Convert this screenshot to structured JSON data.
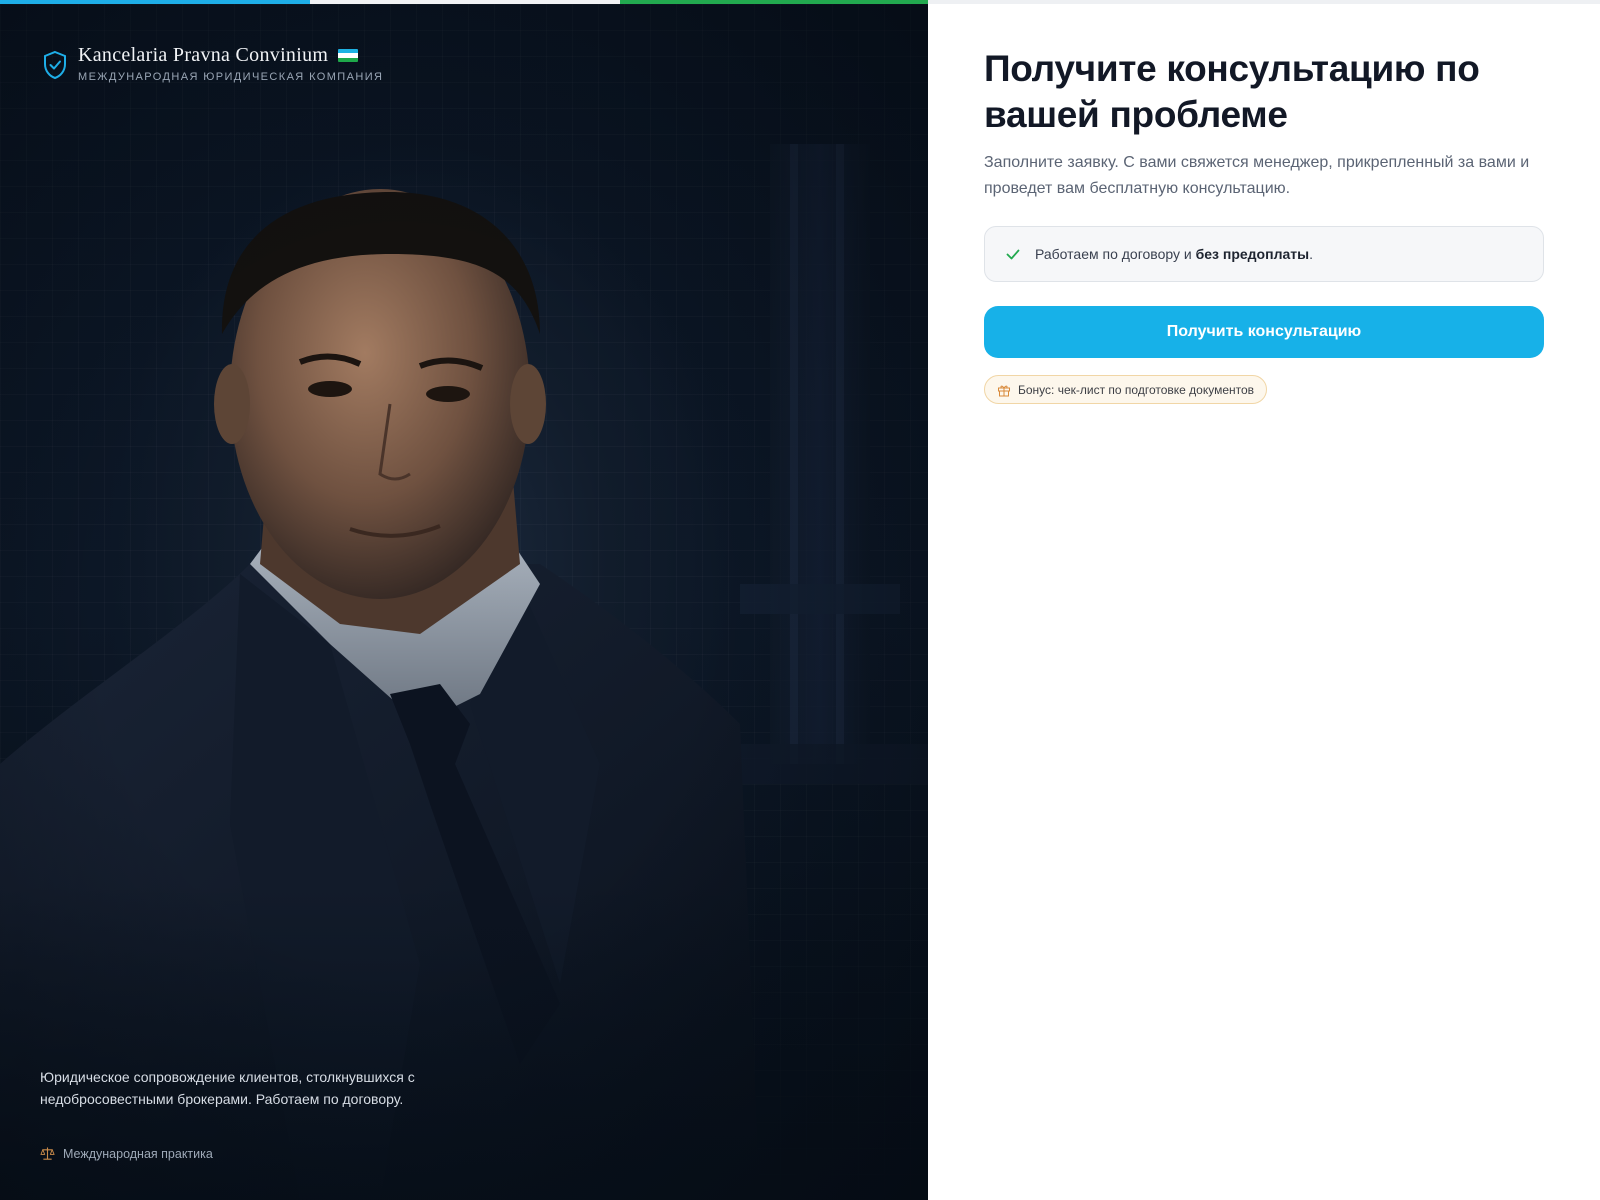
{
  "top_bar": {
    "colors": [
      "#1eaee8",
      "#f1f2f4",
      "#22a94f",
      "#eef0f3"
    ]
  },
  "brand": {
    "name": "Kancelaria Pravna Convinium",
    "subtitle": "МЕЖДУНАРОДНАЯ ЮРИДИЧЕСКАЯ КОМПАНИЯ",
    "icon": "shield-check-icon",
    "flag_icon": "uzbekistan-flag-icon",
    "flag_colors": [
      "#1eb2e3",
      "#ffffff",
      "#1ea84a"
    ]
  },
  "hero": {
    "image": "portrait of a lawyer in a dark suit",
    "caption": "Юридическое сопровождение клиентов, столкнувшихся с недобросовестными брокерами. Работаем по договору.",
    "practice_label": "Международная практика",
    "practice_icon": "scales-icon"
  },
  "form": {
    "title": "Получите консультацию  по вашей проблеме",
    "lead": "Заполните заявку. С вами свяжется менеджер, прикрепленный за вами и проведет вам бесплатную консультацию.",
    "note": {
      "icon": "check-icon",
      "prefix": "Работаем по договору и ",
      "bold": "без предоплаты",
      "suffix": "."
    },
    "cta_label": "Получить консультацию",
    "bonus": {
      "icon": "gift-icon",
      "label": "Бонус: чек-лист по подготовке документов"
    }
  },
  "colors": {
    "accent": "#17b1e8",
    "dark_panel": "#0c1726",
    "check": "#22a94f"
  }
}
